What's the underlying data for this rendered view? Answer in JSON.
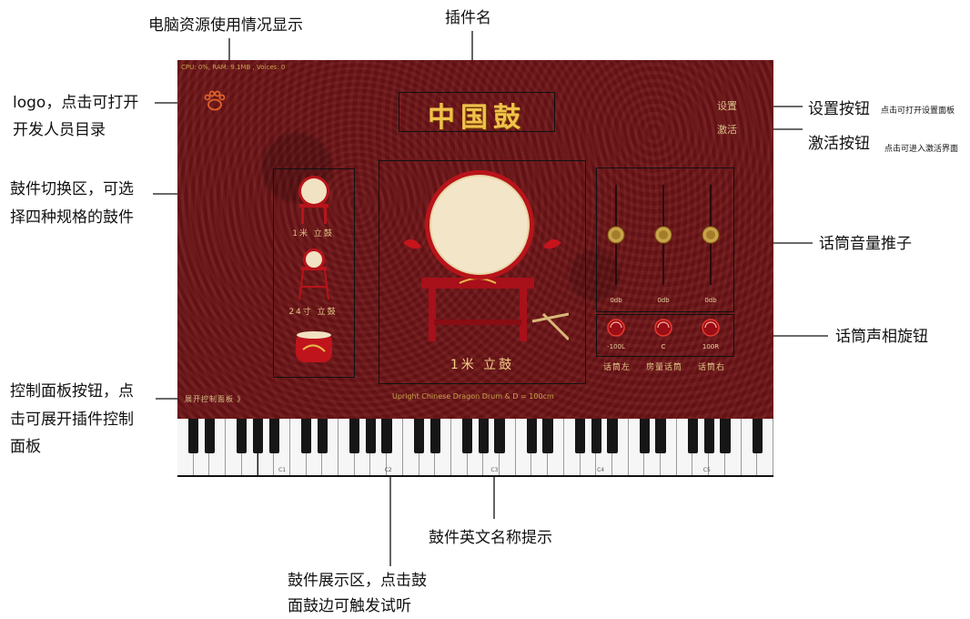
{
  "annotations": {
    "resource": "电脑资源使用情况显示",
    "plugin_name": "插件名",
    "logo": [
      "logo，点击可打开",
      "开发人员目录"
    ],
    "settings_btn": "设置按钮",
    "settings_hint": "点击可打开设置面板",
    "activate_btn": "激活按钮",
    "activate_hint": "点击可进入激活界面",
    "drum_switch": [
      "鼓件切换区，可选",
      "择四种规格的鼓件"
    ],
    "mic_fader": "话筒音量推子",
    "mic_pan": "话筒声相旋钮",
    "control_panel": [
      "控制面板按钮，点",
      "击可展开插件控制",
      "面板"
    ],
    "english_name": "鼓件英文名称提示",
    "drum_display": [
      "鼓件展示区，点击鼓",
      "面鼓边可触发试听"
    ]
  },
  "plugin": {
    "status": "CPU: 0%, RAM: 9.1MB , Voices: 0",
    "title": "中国鼓",
    "settings": "设置",
    "activate": "激活",
    "drums": [
      "1米 立鼓",
      "24寸 立鼓"
    ],
    "main_drum_label": "1米 立鼓",
    "english_name": "Upright Chinese Dragon Drum & D = 100cm",
    "expand_panel": "展开控制面板 》",
    "faders": [
      {
        "label": "0db",
        "level": 0.5
      },
      {
        "label": "0db",
        "level": 0.5
      },
      {
        "label": "0db",
        "level": 0.5
      }
    ],
    "knobs": [
      {
        "value": "-100L",
        "name": "话筒左"
      },
      {
        "value": "C",
        "name": "房量话筒"
      },
      {
        "value": "100R",
        "name": "话筒右"
      }
    ],
    "octaves": [
      "C1",
      "C2",
      "C3",
      "C4",
      "C5"
    ]
  },
  "colors": {
    "background": "#6e1416",
    "gold": "#f0c24a",
    "text_gold": "#e3c78a"
  }
}
